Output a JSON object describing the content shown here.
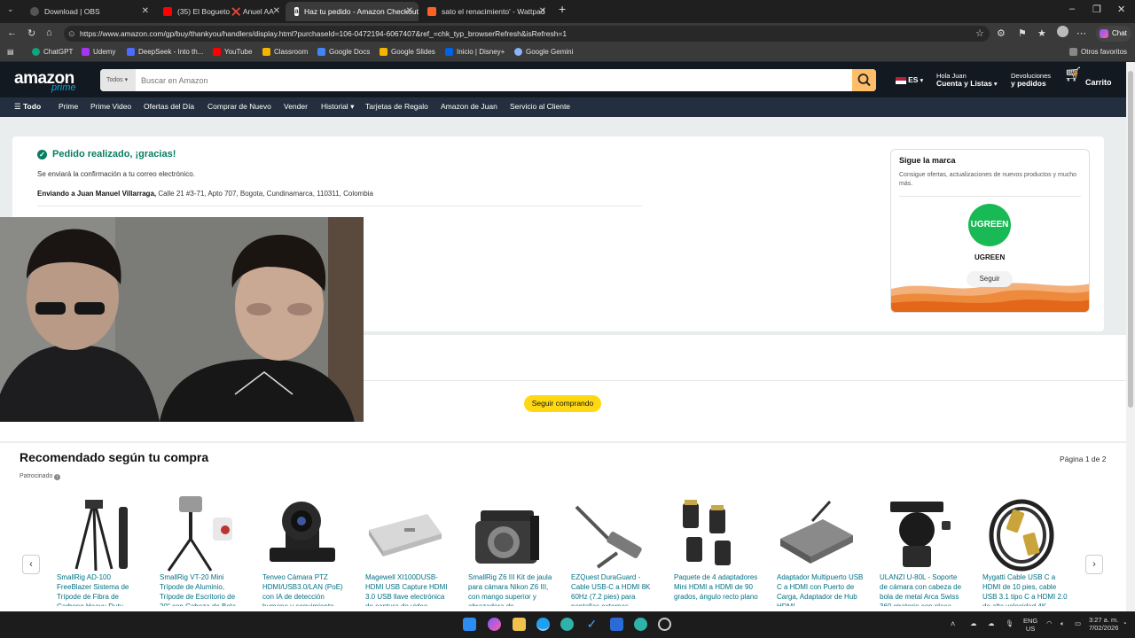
{
  "browser": {
    "tabs": [
      {
        "title": "Download | OBS"
      },
      {
        "title": "(35) El Bogueto ❌ Anuel AA"
      },
      {
        "title": "Haz tu pedido - Amazon Checkout"
      },
      {
        "title": "sato el renacimiento' - Wattpad"
      }
    ],
    "url": "https://www.amazon.com/gp/buy/thankyou/handlers/display.html?purchaseId=106-0472194-6067407&ref_=chk_typ_browserRefresh&isRefresh=1",
    "bookmarks": [
      "ChatGPT",
      "Udemy",
      "DeepSeek - Into th...",
      "YouTube",
      "Classroom",
      "Google Docs",
      "Google Slides",
      "Inicio | Disney+",
      "Google Gemini"
    ],
    "other_bookmarks": "Otros favoritos",
    "chat_label": "Chat"
  },
  "amazon": {
    "logo": "amazon",
    "logo_sub": "prime",
    "search_category": "Todos",
    "search_placeholder": "Buscar en Amazon",
    "lang": "ES",
    "account_line1": "Hola Juan",
    "account_line2": "Cuenta y Listas",
    "orders_line1": "Devoluciones",
    "orders_line2": "y pedidos",
    "cart_count": "0",
    "cart_label": "Carrito",
    "nav": [
      "Todo",
      "Prime",
      "Prime Video",
      "Ofertas del Día",
      "Comprar de Nuevo",
      "Vender",
      "Historial",
      "Tarjetas de Regalo",
      "Amazon de Juan",
      "Servicio al Cliente"
    ]
  },
  "order": {
    "title": "Pedido realizado, ¡gracias!",
    "confirmation": "Se enviará la confirmación a tu correo electrónico.",
    "shipping_label": "Enviando a Juan Manuel Villarraga,",
    "shipping_address": "Calle 21 #3-71, Apto 707, Bogota, Cundinamarca, 110311, Colombia",
    "continue_button": "Seguir comprando"
  },
  "brand_panel": {
    "heading": "Sigue la marca",
    "description": "Consigue ofertas, actualizaciones de nuevos productos y mucho más.",
    "logo_text": "UGREEN",
    "brand_name": "UGREEN",
    "follow_button": "Seguir"
  },
  "recommendations": {
    "title": "Recomendado según tu compra",
    "page_indicator": "Página 1 de 2",
    "sponsored": "Patrocinado",
    "products": [
      {
        "name": "SmallRig AD-100 FreeBlazer Sistema de Trípode de Fibra de Carbono Heavy-Duty"
      },
      {
        "name": "SmallRig VT-20 Mini Trípode de Aluminio, Trípode de Escritorio de 20\" con Cabeza de Bola"
      },
      {
        "name": "Tenveo Cámara PTZ HDMI/USB3.0/LAN (PoE) con IA de detección humana y seguimiento"
      },
      {
        "name": "Magewell XI100DUSB-HDMI USB Capture HDMI 3.0 USB llave electrónica de captura de video"
      },
      {
        "name": "SmallRig Z6 III Kit de jaula para cámara Nikon Z6 III, con mango superior y abrazadera de"
      },
      {
        "name": "EZQuest DuraGuard - Cable USB-C a HDMI 8K 60Hz (7.2 pies) para pantallas externas"
      },
      {
        "name": "Paquete de 4 adaptadores Mini HDMI a HDMI de 90 grados, ángulo recto plano"
      },
      {
        "name": "Adaptador Multipuerto USB C a HDMI con Puerto de Carga, Adaptador de Hub HDMI"
      },
      {
        "name": "ULANZI U-80L - Soporte de cámara con cabeza de bola de metal Arca Swiss 360 giratorio con placa"
      },
      {
        "name": "Mygatti Cable USB C a HDMI de 10 pies, cable USB 3.1 tipo C a HDMI 2.0 de alta velocidad 4K"
      }
    ]
  },
  "system": {
    "time": "3:27 a. m.",
    "date": "7/02/2026",
    "lang_top": "ENG",
    "lang_bottom": "US"
  },
  "colors": {
    "amazon_dark": "#131921",
    "amazon_nav": "#232f3e",
    "search_button": "#febd69",
    "success_green": "#067d62",
    "cta_yellow": "#ffd814",
    "link_teal": "#007185",
    "ugreen_green": "#19b955"
  }
}
